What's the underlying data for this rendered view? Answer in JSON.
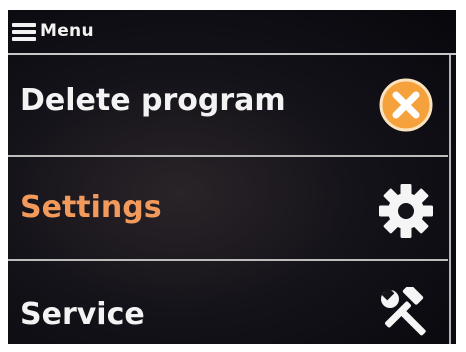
{
  "header": {
    "title": "Menu",
    "icon": "hamburger-menu-icon"
  },
  "menu": {
    "items": [
      {
        "label": "Delete program",
        "icon": "delete-icon",
        "selected": false
      },
      {
        "label": "Settings",
        "icon": "gear-icon",
        "selected": true
      },
      {
        "label": "Service",
        "icon": "tools-icon",
        "selected": false
      }
    ]
  },
  "colors": {
    "background": "#0d0c12",
    "text": "#f3f3f3",
    "selected_text": "#f29a5c",
    "delete_icon_fill": "#f5a23c",
    "divider": "#bdbdbd"
  }
}
